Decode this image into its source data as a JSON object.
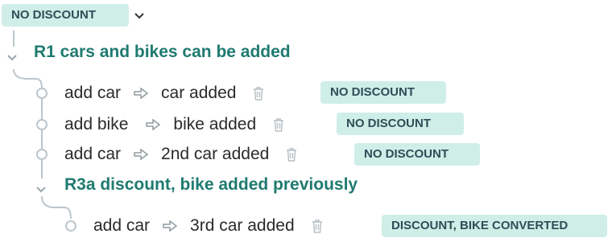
{
  "root": {
    "badge": "NO DISCOUNT"
  },
  "rules": [
    {
      "title": "R1 cars and bikes can be added",
      "steps": [
        {
          "action": "add car",
          "result": "car added",
          "badge": "NO DISCOUNT"
        },
        {
          "action": "add bike",
          "result": "bike added",
          "badge": "NO DISCOUNT"
        },
        {
          "action": "add car",
          "result": "2nd car added",
          "badge": "NO DISCOUNT"
        }
      ]
    },
    {
      "title": "R3a discount, bike added previously",
      "steps": [
        {
          "action": "add car",
          "result": "3rd car added",
          "badge": "DISCOUNT, BIKE CONVERTED"
        }
      ]
    }
  ],
  "colors": {
    "badge_bg": "#cfeee8",
    "rule_title": "#1f7a70",
    "tree_line": "#bcc6cc"
  }
}
